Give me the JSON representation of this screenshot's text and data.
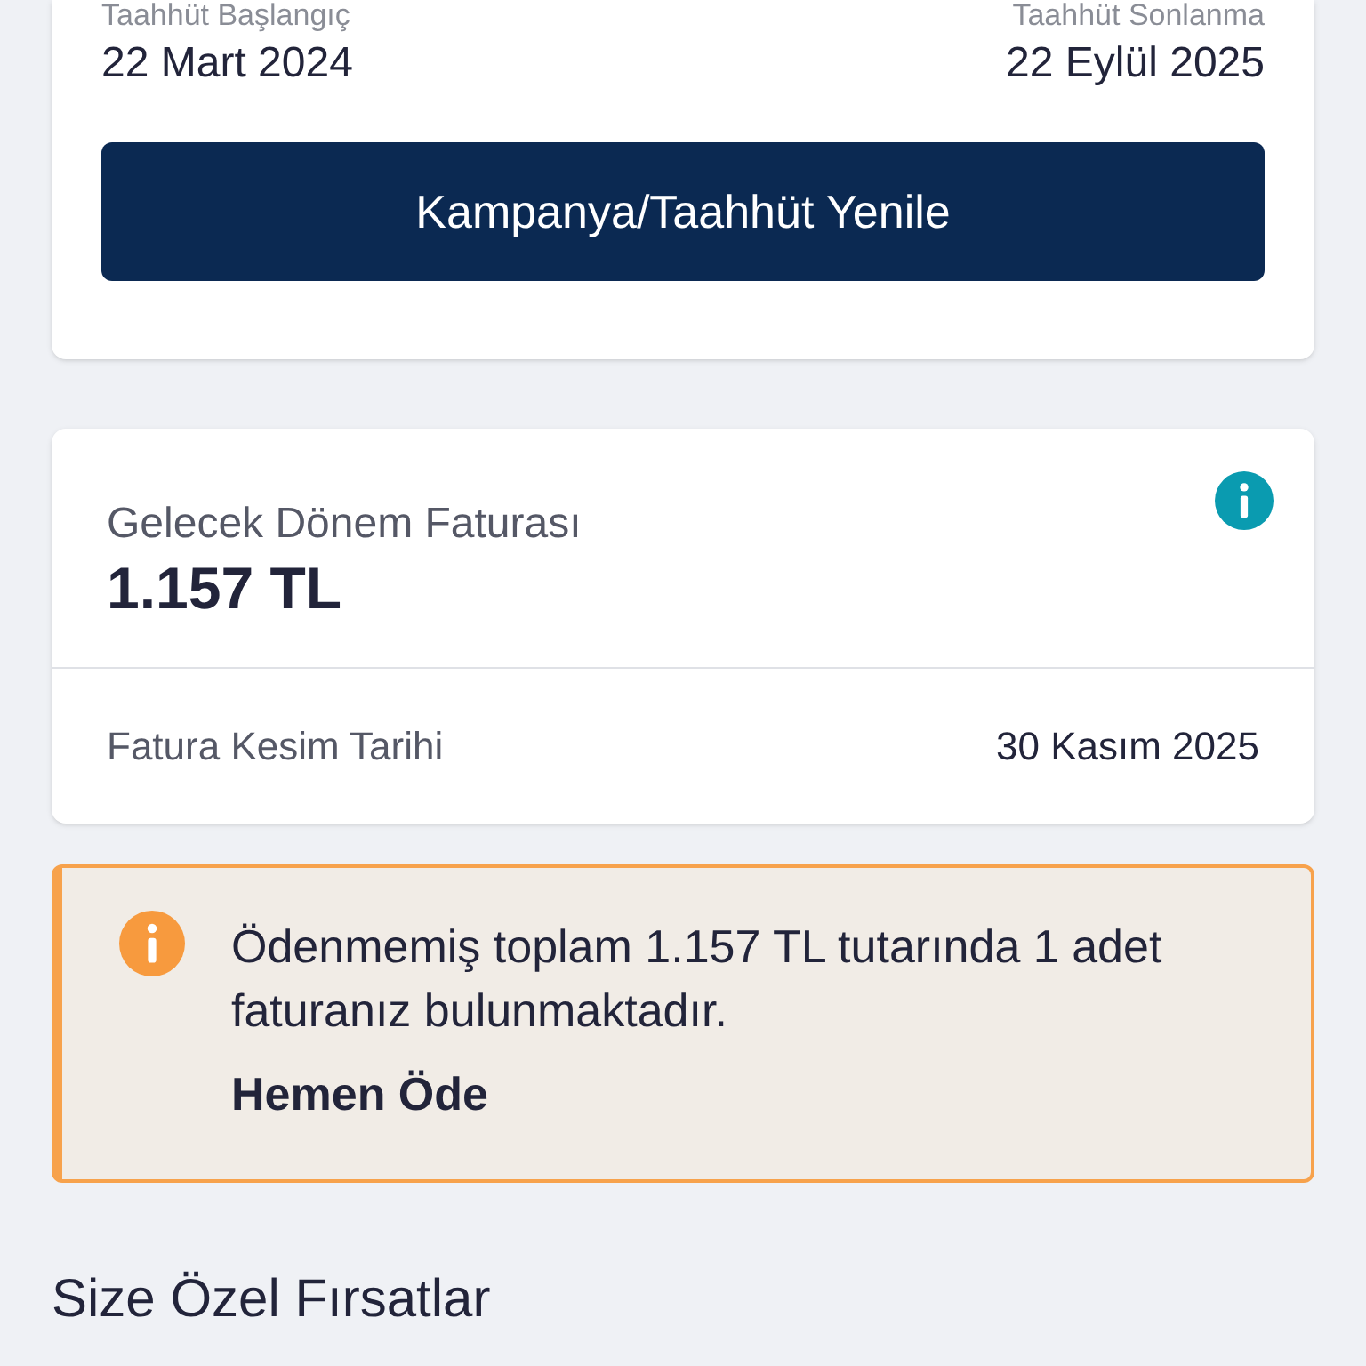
{
  "commitment": {
    "start_label": "Taahhüt Başlangıç",
    "start_date": "22 Mart 2024",
    "end_label": "Taahhüt Sonlanma",
    "end_date": "22 Eylül 2025",
    "renew_button": "Kampanya/Taahhüt Yenile"
  },
  "next_bill": {
    "label": "Gelecek Dönem Faturası",
    "amount": "1.157 TL",
    "cutoff_label": "Fatura Kesim Tarihi",
    "cutoff_date": "30 Kasım 2025"
  },
  "alert": {
    "message": "Ödenmemiş toplam 1.157 TL tutarında 1 adet faturanız bulunmaktadır.",
    "action": "Hemen Öde"
  },
  "section_title": "Size Özel Fırsatlar"
}
